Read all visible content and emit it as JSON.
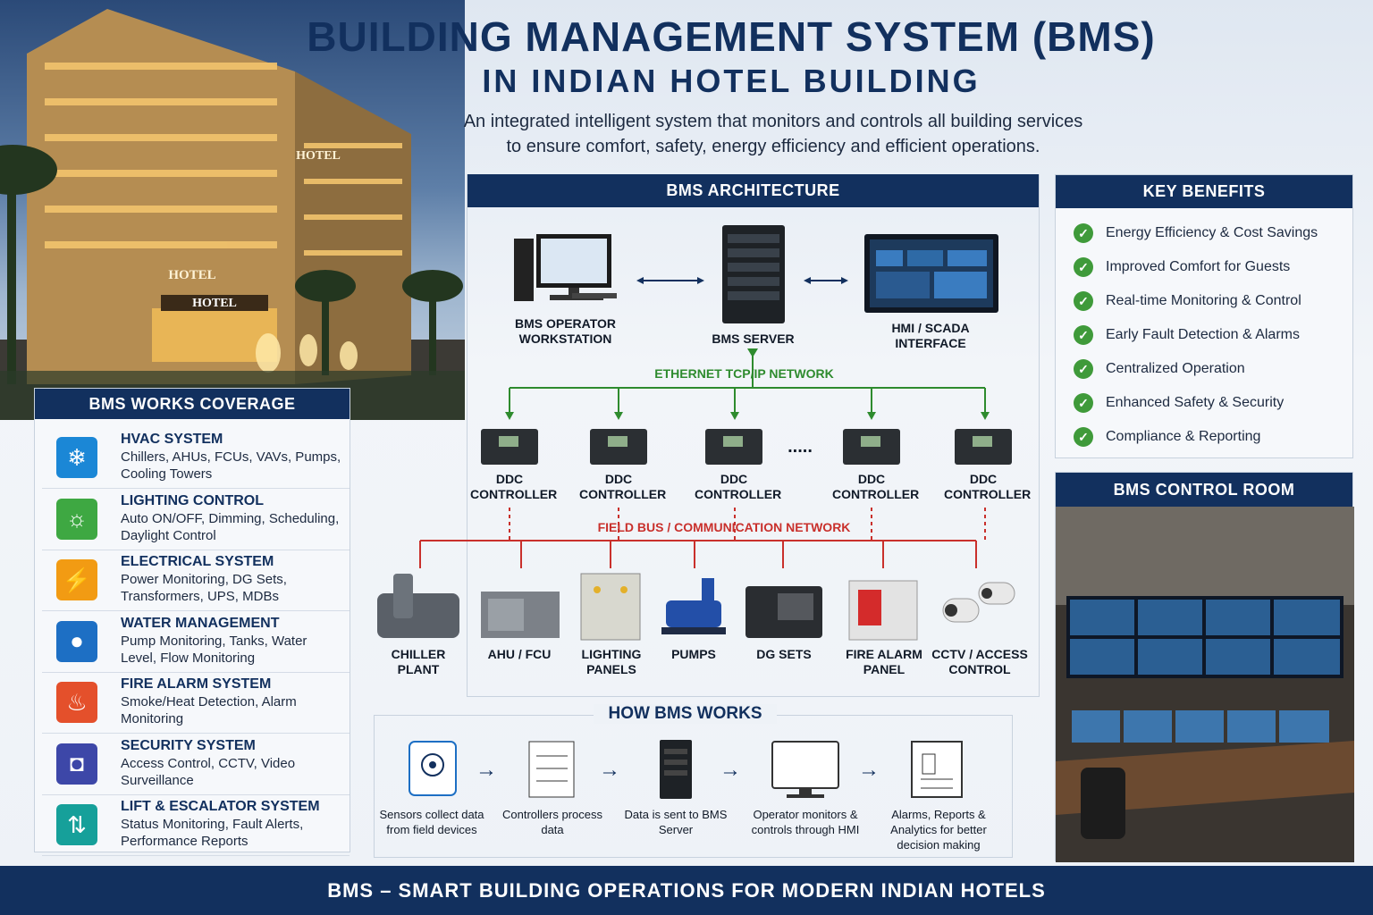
{
  "header": {
    "title": "BUILDING MANAGEMENT SYSTEM (BMS)",
    "subtitle": "IN INDIAN HOTEL BUILDING",
    "description_line1": "An integrated intelligent system that monitors and controls all building services",
    "description_line2": "to ensure comfort, safety, energy efficiency and efficient operations."
  },
  "photo": {
    "sign_1": "HOTEL",
    "sign_2": "HOTEL",
    "sign_3": "HOTEL"
  },
  "coverage": {
    "title": "BMS WORKS COVERAGE",
    "items": [
      {
        "title": "HVAC SYSTEM",
        "desc": "Chillers, AHUs, FCUs, VAVs, Pumps, Cooling Towers",
        "icon": "snowflake-icon",
        "color": "#1b87d6"
      },
      {
        "title": "LIGHTING CONTROL",
        "desc": "Auto ON/OFF, Dimming, Scheduling, Daylight Control",
        "icon": "lightbulb-icon",
        "color": "#3ea842"
      },
      {
        "title": "ELECTRICAL SYSTEM",
        "desc": "Power Monitoring, DG Sets, Transformers, UPS, MDBs",
        "icon": "plug-icon",
        "color": "#f29b13"
      },
      {
        "title": "WATER MANAGEMENT",
        "desc": "Pump Monitoring, Tanks, Water Level, Flow Monitoring",
        "icon": "water-drop-icon",
        "color": "#1d6fc4"
      },
      {
        "title": "FIRE ALARM SYSTEM",
        "desc": "Smoke/Heat Detection, Alarm Monitoring",
        "icon": "flame-icon",
        "color": "#e4502b"
      },
      {
        "title": "SECURITY SYSTEM",
        "desc": "Access Control, CCTV, Video Surveillance",
        "icon": "cctv-icon",
        "color": "#3d47a8"
      },
      {
        "title": "LIFT & ESCALATOR SYSTEM",
        "desc": "Status Monitoring, Fault Alerts, Performance Reports",
        "icon": "elevator-icon",
        "color": "#16a09a"
      }
    ]
  },
  "architecture": {
    "title": "BMS ARCHITECTURE",
    "workstation": "BMS OPERATOR WORKSTATION",
    "server": "BMS SERVER",
    "hmi": "HMI / SCADA INTERFACE",
    "ethernet": "ETHERNET TCP/IP NETWORK",
    "fieldbus": "FIELD BUS / COMMUNICATION NETWORK",
    "controller_label": "DDC CONTROLLER",
    "ellipsis": ".....",
    "equipment": [
      "CHILLER PLANT",
      "AHU / FCU",
      "LIGHTING PANELS",
      "PUMPS",
      "DG SETS",
      "FIRE ALARM PANEL",
      "CCTV / ACCESS CONTROL"
    ]
  },
  "how": {
    "title": "HOW BMS WORKS",
    "steps": [
      "Sensors collect data from field devices",
      "Controllers process data",
      "Data is sent to BMS Server",
      "Operator monitors & controls through HMI",
      "Alarms, Reports & Analytics for better decision making"
    ]
  },
  "benefits": {
    "title": "KEY BENEFITS",
    "items": [
      "Energy Efficiency & Cost Savings",
      "Improved Comfort for Guests",
      "Real-time Monitoring & Control",
      "Early Fault Detection & Alarms",
      "Centralized Operation",
      "Enhanced Safety & Security",
      "Compliance & Reporting"
    ]
  },
  "control_room": {
    "title": "BMS CONTROL ROOM"
  },
  "footer": {
    "text": "BMS – SMART BUILDING OPERATIONS FOR MODERN INDIAN HOTELS"
  },
  "colors": {
    "navy": "#12305e",
    "ethernet": "#2e8b2e",
    "fieldbus": "#c9302c"
  }
}
